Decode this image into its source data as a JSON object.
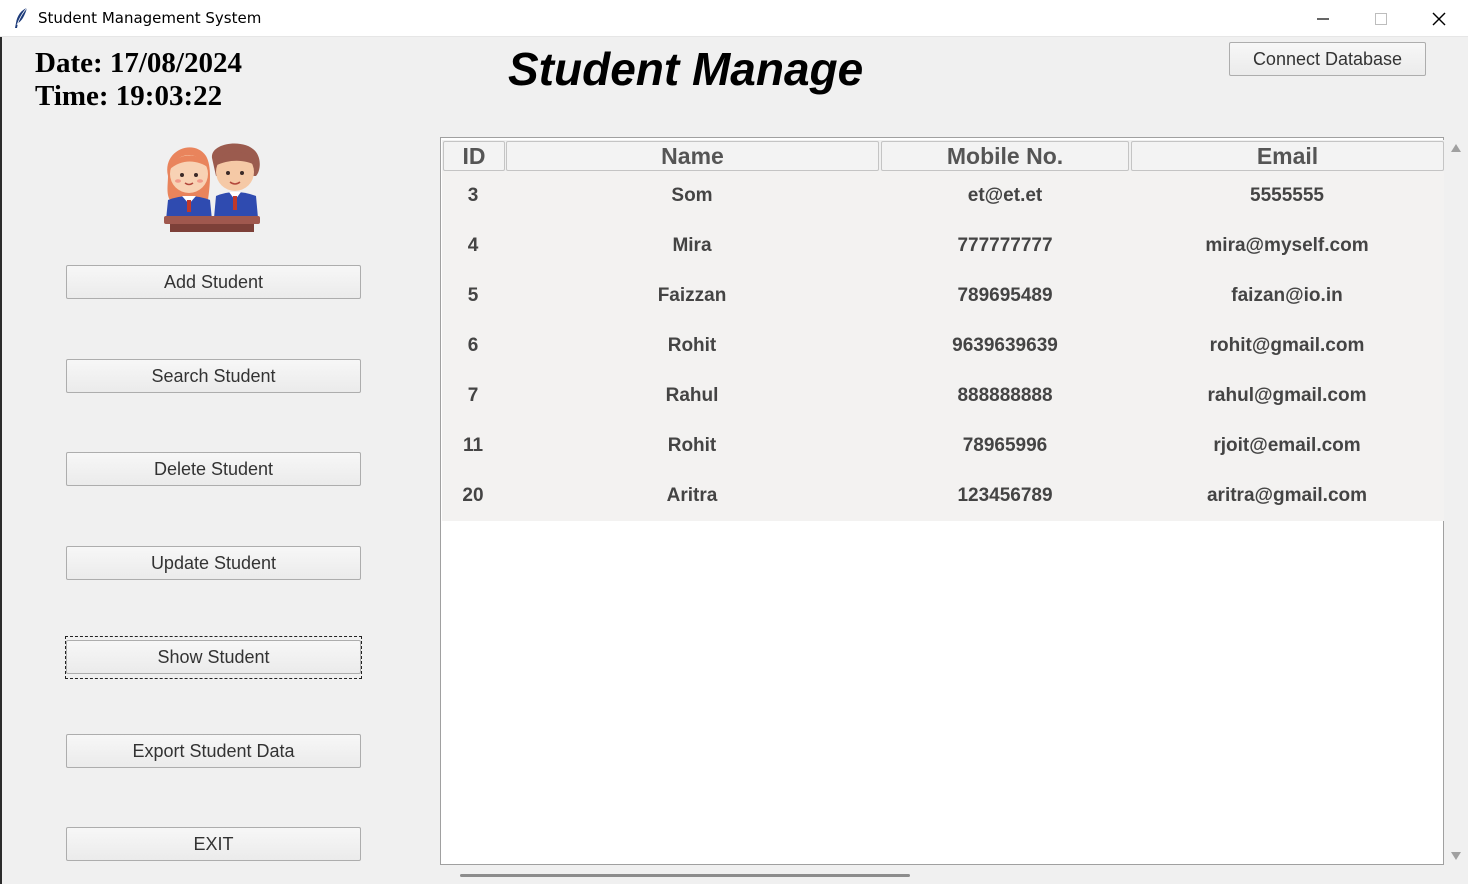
{
  "window": {
    "title": "Student Management System"
  },
  "header": {
    "date": "Date: 17/08/2024",
    "time": "Time: 19:03:22",
    "title": "Student Manage",
    "connect_label": "Connect Database"
  },
  "sidebar": {
    "add": "Add Student",
    "search": "Search Student",
    "delete": "Delete Student",
    "update": "Update Student",
    "show": "Show Student",
    "export": "Export Student Data",
    "exit": "EXIT"
  },
  "table": {
    "columns": [
      "ID",
      "Name",
      "Mobile No.",
      "Email"
    ],
    "rows": [
      [
        "3",
        "Som",
        "et@et.et",
        "5555555"
      ],
      [
        "4",
        "Mira",
        "777777777",
        "mira@myself.com"
      ],
      [
        "5",
        "Faizzan",
        "789695489",
        "faizan@io.in"
      ],
      [
        "6",
        "Rohit",
        "9639639639",
        "rohit@gmail.com"
      ],
      [
        "7",
        "Rahul",
        "888888888",
        "rahul@gmail.com"
      ],
      [
        "11",
        "Rohit",
        "78965996",
        "rjoit@email.com"
      ],
      [
        "20",
        "Aritra",
        "123456789",
        "aritra@gmail.com"
      ]
    ]
  }
}
